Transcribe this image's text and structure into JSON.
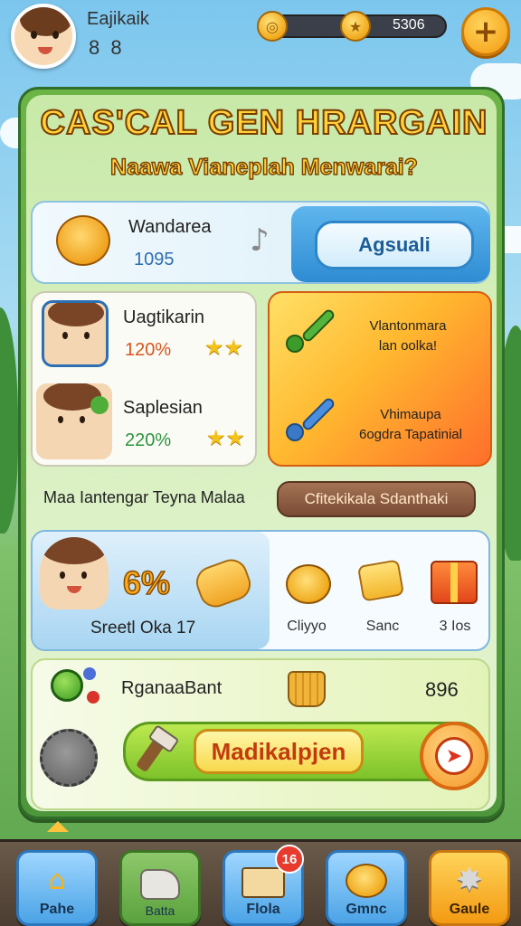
{
  "player": {
    "name": "Eajikaik",
    "level": "8 8"
  },
  "currency": {
    "amount": "5306"
  },
  "header": {
    "title": "CAS'CAL GEN HRARGAIN",
    "subtitle": "Naawa Vianeplah Menwarai?"
  },
  "wander": {
    "label": "Wandarea",
    "value": "1095",
    "button": "Agsuali"
  },
  "friends": [
    {
      "name": "Uagtikarin",
      "percent": "120%"
    },
    {
      "name": "Saplesian",
      "percent": "220%"
    }
  ],
  "promo": {
    "line1": [
      "Vlantonmara",
      "lan oolka!"
    ],
    "line2": [
      "Vhimaupa",
      "6ogdra Tapatinial"
    ]
  },
  "banner": {
    "text": "Maa Iantengar Teyna Malaa",
    "button": "Cfitekikala Sdanthaki"
  },
  "reward": {
    "percent": "6%",
    "caption": "Sreetl Oka 17",
    "items": [
      {
        "label": "Cliyyo"
      },
      {
        "label": "Sanc"
      },
      {
        "label": "3 Ios"
      }
    ]
  },
  "quest": {
    "label": "RganaaBant",
    "value": "896",
    "button": "Madikalpjen"
  },
  "nav": {
    "items": [
      {
        "label": "Pahe",
        "icon": "home-icon"
      },
      {
        "label": "Batta",
        "icon": "battle-icon"
      },
      {
        "label": "Flola",
        "icon": "shop-icon",
        "badge": "16"
      },
      {
        "label": "Gmnc",
        "icon": "coins-icon"
      },
      {
        "label": "Gaule",
        "icon": "settings-icon"
      }
    ]
  }
}
